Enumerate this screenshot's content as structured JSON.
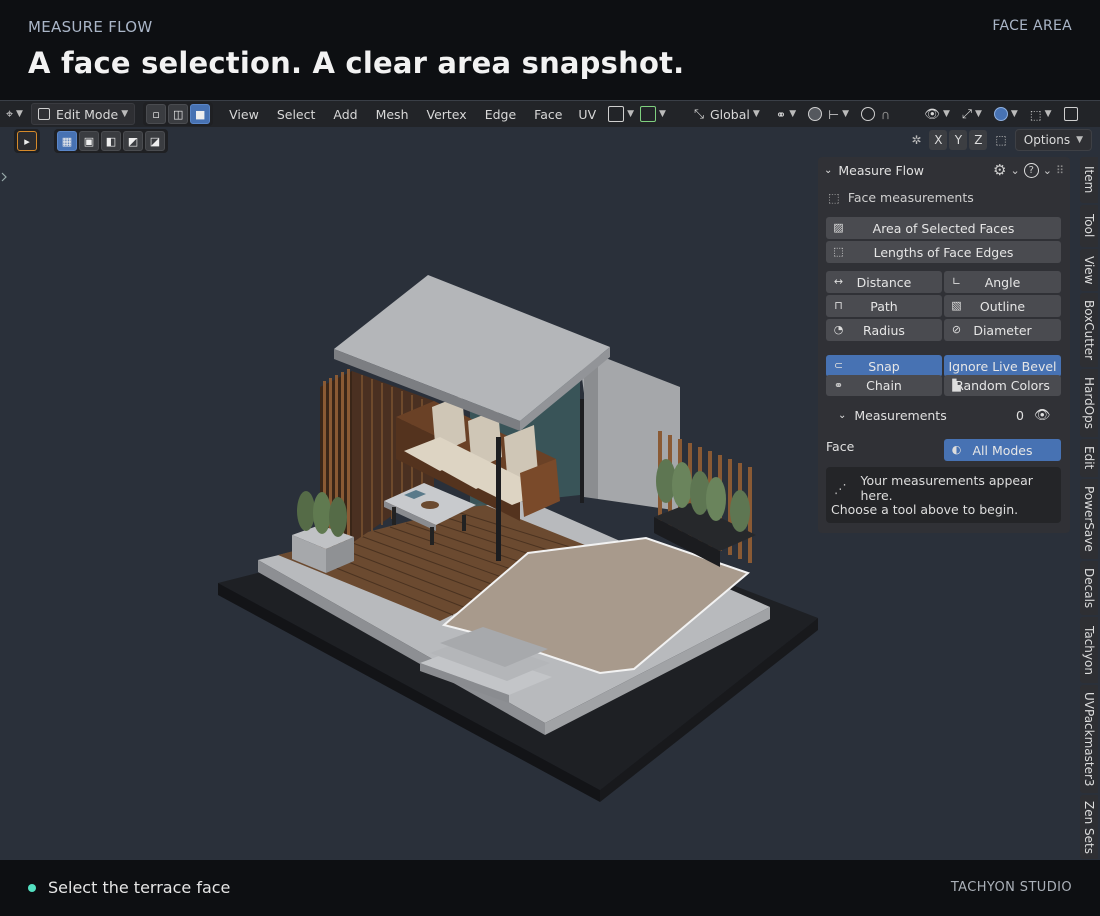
{
  "banner": {
    "eyebrow": "MEASURE FLOW",
    "tag": "FACE AREA",
    "headline": "A face selection. A clear area snapshot."
  },
  "header": {
    "mode": "Edit Mode",
    "menus": [
      "View",
      "Select",
      "Add",
      "Mesh",
      "Vertex",
      "Edge",
      "Face",
      "UV"
    ],
    "orientation": "Global"
  },
  "tool_row": {
    "axes": [
      "X",
      "Y",
      "Z"
    ],
    "options": "Options"
  },
  "panel": {
    "title": "Measure Flow",
    "section": "Face measurements",
    "area_button": "Area of Selected Faces",
    "lengths_button": "Lengths of Face Edges",
    "distance": "Distance",
    "angle": "Angle",
    "path": "Path",
    "outline": "Outline",
    "radius": "Radius",
    "diameter": "Diameter",
    "snap": "Snap",
    "ignore_bevel": "Ignore Live Bevel",
    "chain": "Chain",
    "random_colors": "Random Colors",
    "measurements_label": "Measurements",
    "measurements_count": "0",
    "face_label": "Face",
    "modes": "All Modes",
    "info_line1": "Your measurements appear here.",
    "info_line2": "Choose a tool above to begin."
  },
  "tabs": [
    "Item",
    "Tool",
    "View",
    "BoxCutter",
    "HardOps",
    "Edit",
    "PowerSave",
    "Decals",
    "Tachyon",
    "UVPackmaster3",
    "Zen Sets"
  ],
  "footer": {
    "hint": "Select the terrace face",
    "brand": "TACHYON STUDIO"
  },
  "colors": {
    "accent": "#4772b3",
    "status_dot": "#53e0c1",
    "viewport_bg": "#2a303a"
  }
}
